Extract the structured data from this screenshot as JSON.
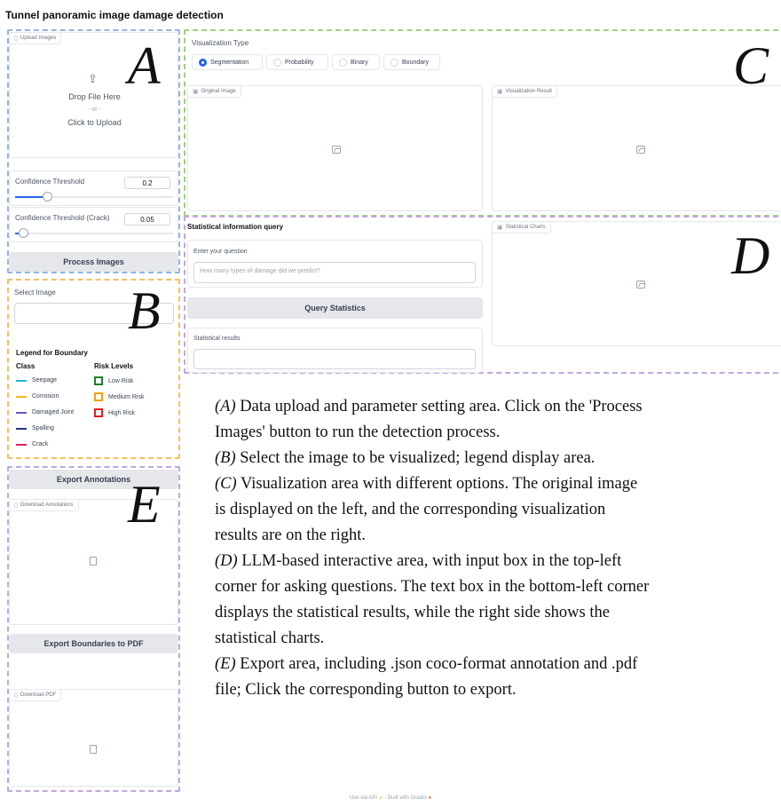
{
  "title": "Tunnel panoramic image damage detection",
  "colors": {
    "A": "#93b4e6",
    "B": "#f3c15b",
    "C": "#9ed17f",
    "D": "#c3a6df",
    "E": "#c3a6df",
    "accent": "#2563eb"
  },
  "letters": {
    "A": "A",
    "B": "B",
    "C": "C",
    "D": "D",
    "E": "E"
  },
  "upload": {
    "tag": "Upload Images",
    "drop": "Drop File Here",
    "or": "- or -",
    "click": "Click to Upload"
  },
  "confidence": {
    "label": "Confidence Threshold",
    "value": "0.2",
    "fraction": 0.2
  },
  "confidence_crack": {
    "label": "Confidence Threshold (Crack)",
    "value": "0.05",
    "fraction": 0.05
  },
  "process_button": "Process Images",
  "select_image": {
    "label": "Select Image",
    "value": ""
  },
  "legend": {
    "title": "Legend for Boundary",
    "class_header": "Class",
    "risk_header": "Risk Levels",
    "classes": [
      {
        "name": "Seepage",
        "color": "#22b5e8"
      },
      {
        "name": "Corrosion",
        "color": "#f5b921"
      },
      {
        "name": "Damaged Joint",
        "color": "#6658c8"
      },
      {
        "name": "Spalling",
        "color": "#1e3a8a"
      },
      {
        "name": "Crack",
        "color": "#e0245e"
      }
    ],
    "risks": [
      {
        "name": "Low Risk",
        "color": "#1a7f2b"
      },
      {
        "name": "Medium Risk",
        "color": "#f59e0b"
      },
      {
        "name": "High Risk",
        "color": "#e11d1d"
      }
    ]
  },
  "export_annotations": {
    "button": "Export Annotations",
    "tag": "Download Annotations"
  },
  "export_pdf": {
    "button": "Export Boundaries to PDF",
    "tag": "Download PDF"
  },
  "visualization": {
    "label": "Visualization Type",
    "options": [
      "Segmentation",
      "Probability",
      "Binary",
      "Boundary"
    ],
    "selected": "Segmentation",
    "original_tag": "Original Image",
    "result_tag": "Visualization Result"
  },
  "stats": {
    "heading": "Statistical information query",
    "question_label": "Enter your question",
    "question_placeholder": "How many types of damage did we predict?",
    "query_button": "Query Statistics",
    "results_label": "Statistical results",
    "results_value": "",
    "charts_tag": "Statistical Charts"
  },
  "description": [
    {
      "key": "(A)",
      "text": " Data upload and parameter setting area. Click on the 'Process"
    },
    {
      "key": "",
      "text": "Images' button to run the detection process."
    },
    {
      "key": "(B)",
      "text": " Select the image to be visualized; legend display area."
    },
    {
      "key": "(C)",
      "text": " Visualization area with different options. The original image"
    },
    {
      "key": "",
      "text": "is displayed on the left, and the corresponding visualization"
    },
    {
      "key": "",
      "text": "results are on the right."
    },
    {
      "key": "(D)",
      "text": " LLM-based interactive area, with input box in the top-left"
    },
    {
      "key": "",
      "text": "corner for asking questions. The text box in the bottom-left corner"
    },
    {
      "key": "",
      "text": "displays the statistical results, while the right side shows the"
    },
    {
      "key": "",
      "text": "statistical charts."
    },
    {
      "key": "(E)",
      "text": " Export area, including .json coco-format annotation and .pdf"
    },
    {
      "key": "",
      "text": "file; Click the corresponding button to export."
    }
  ],
  "footer": {
    "api": "Use via API",
    "sep": "·",
    "built": "Built with Gradio"
  }
}
